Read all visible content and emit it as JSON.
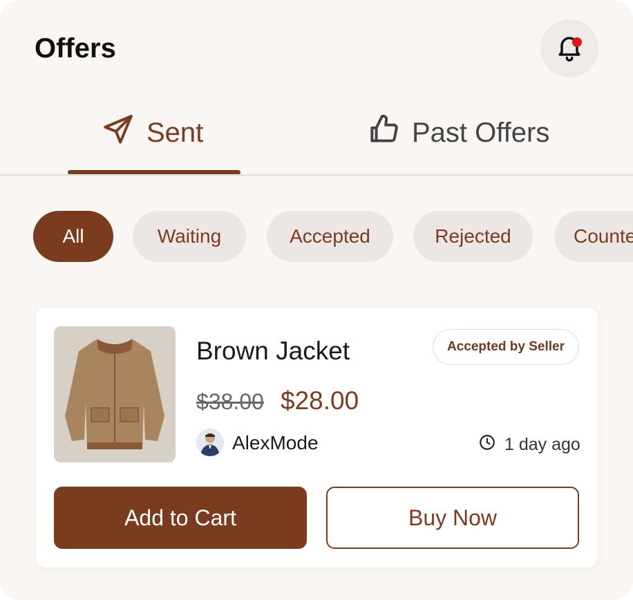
{
  "header": {
    "title": "Offers",
    "notification_icon": "bell-icon",
    "has_unread": true
  },
  "tabs": [
    {
      "label": "Sent",
      "icon": "send-icon",
      "active": true
    },
    {
      "label": "Past Offers",
      "icon": "thumbs-up-icon",
      "active": false
    }
  ],
  "filters": [
    {
      "label": "All",
      "active": true
    },
    {
      "label": "Waiting",
      "active": false
    },
    {
      "label": "Accepted",
      "active": false
    },
    {
      "label": "Rejected",
      "active": false
    },
    {
      "label": "Counter",
      "active": false
    }
  ],
  "offer": {
    "product_name": "Brown Jacket",
    "status": "Accepted by Seller",
    "original_price": "$38.00",
    "offer_price": "$28.00",
    "seller": "AlexMode",
    "time_ago": "1 day ago",
    "primary_action": "Add to Cart",
    "secondary_action": "Buy Now"
  },
  "colors": {
    "accent": "#7b3b1e",
    "background": "#f9f6f4",
    "chip_bg": "#ece7e4",
    "notification_dot": "#e0141b"
  }
}
